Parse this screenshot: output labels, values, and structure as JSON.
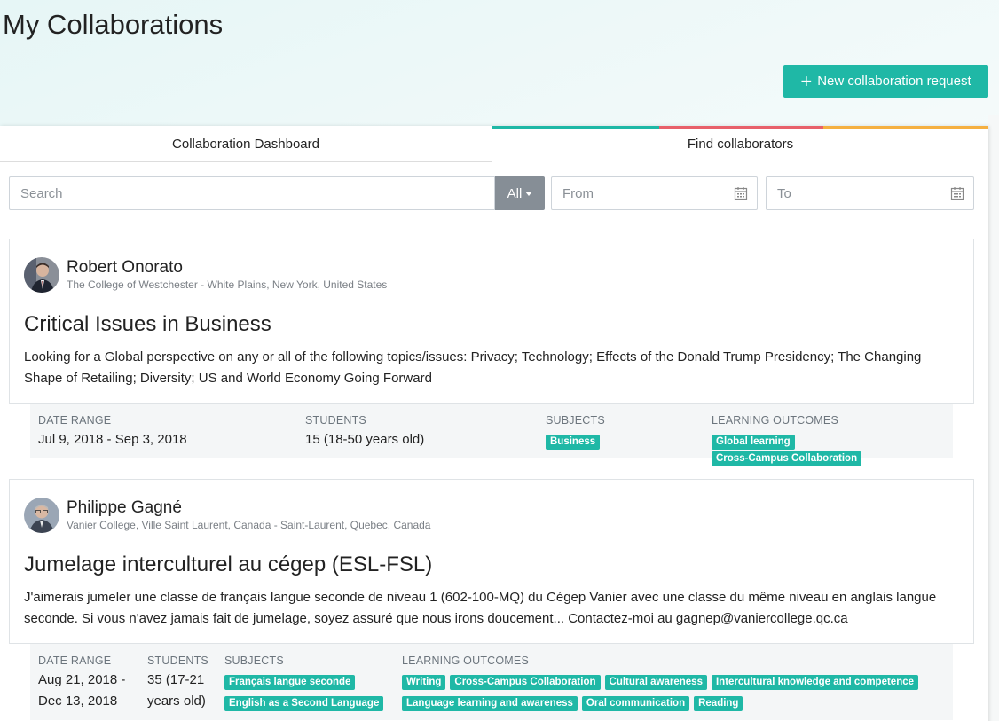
{
  "page": {
    "title": "My Collaborations"
  },
  "actions": {
    "new_request_label": "New collaboration request"
  },
  "tabs": [
    {
      "label": "Collaboration Dashboard",
      "active": false
    },
    {
      "label": "Find collaborators",
      "active": true
    }
  ],
  "filters": {
    "search_placeholder": "Search",
    "category_label": "All",
    "from_placeholder": "From",
    "to_placeholder": "To"
  },
  "meta_labels": {
    "date_range": "DATE RANGE",
    "students": "STUDENTS",
    "subjects": "SUBJECTS",
    "learning_outcomes": "LEARNING OUTCOMES"
  },
  "posts": [
    {
      "author": "Robert Onorato",
      "institution": "The College of Westchester - White Plains, New York, United States",
      "title": "Critical Issues in Business",
      "description": "Looking for a Global perspective on any or all of the following topics/issues: Privacy; Technology; Effects of the Donald Trump Presidency; The Changing Shape of Retailing; Diversity; US and World Economy Going Forward",
      "date_range": "Jul 9, 2018 - Sep 3, 2018",
      "students": "15 (18-50 years old)",
      "subjects": [
        "Business"
      ],
      "learning_outcomes": [
        "Global learning",
        "Cross-Campus Collaboration"
      ]
    },
    {
      "author": "Philippe Gagné",
      "institution": "Vanier College, Ville Saint Laurent, Canada - Saint-Laurent, Quebec, Canada",
      "title": "Jumelage interculturel au cégep (ESL-FSL)",
      "description": "J'aimerais jumeler une classe de français langue seconde de niveau 1 (602-100-MQ) du Cégep Vanier avec une classe du même niveau en anglais langue seconde. Si vous n'avez jamais fait de jumelage, soyez assuré que nous irons doucement... Contactez-moi au gagnep@vaniercollege.qc.ca",
      "date_range_line1": "Aug 21, 2018 -",
      "date_range_line2": "Dec 13, 2018",
      "students_line1": "35 (17-21",
      "students_line2": "years old)",
      "subjects": [
        "Français langue seconde",
        "English as a Second Language"
      ],
      "learning_outcomes": [
        "Writing",
        "Cross-Campus Collaboration",
        "Cultural awareness",
        "Intercultural knowledge and competence",
        "Language learning and awareness",
        "Oral communication",
        "Reading"
      ]
    }
  ],
  "colors": {
    "accent": "#1fb8a6",
    "tab_bar_teal": "#1fb8a6",
    "tab_bar_red": "#e8606a",
    "tab_bar_orange": "#f5b041",
    "all_button": "#868e96"
  },
  "icons": {
    "plus": "plus-icon",
    "calendar": "calendar-icon",
    "caret": "caret-down-icon"
  }
}
